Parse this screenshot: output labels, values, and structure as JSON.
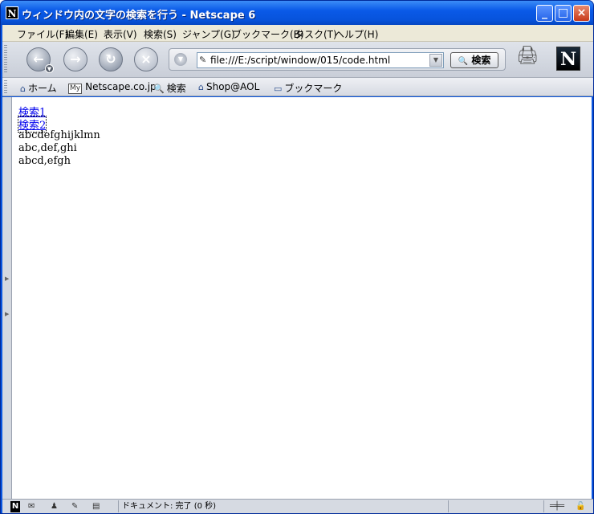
{
  "window": {
    "app_icon": "N",
    "title": "ウィンドウ内の文字の検索を行う - Netscape 6",
    "min_glyph": "_",
    "max_glyph": "□",
    "close_glyph": "×"
  },
  "menu": [
    "ファイル(F)",
    "編集(E)",
    "表示(V)",
    "検索(S)",
    "ジャンプ(G)",
    "ブックマーク(B)",
    "タスク(T)",
    "ヘルプ(H)"
  ],
  "nav": {
    "back_glyph": "←",
    "forward_glyph": "→",
    "reload_glyph": "↻",
    "stop_glyph": "×",
    "url": "file:///E:/script/window/015/code.html",
    "search_label": "検索",
    "search_glyph": "🔍",
    "logo": "N"
  },
  "personal_bar": {
    "home": "ホーム",
    "my_badge": "My",
    "netscape": "Netscape.co.jp",
    "search": "検索",
    "shop": "Shop@AOL",
    "bookmarks": "ブックマーク"
  },
  "content": {
    "link1": "検索1",
    "link2": "検索2",
    "line1": "abcdefghijklmn",
    "line2": "abc,def,ghi",
    "line3": "abcd,efgh"
  },
  "status": {
    "text": "ドキュメント: 完了 (0 秒)"
  },
  "icons": [
    "netscape-icon",
    "back-icon",
    "forward-icon",
    "reload-icon",
    "stop-icon",
    "search-icon",
    "print-icon",
    "home-icon",
    "shop-icon",
    "folder-icon",
    "mail-icon",
    "aim-icon",
    "composer-icon",
    "address-book-icon",
    "lock-icon"
  ]
}
